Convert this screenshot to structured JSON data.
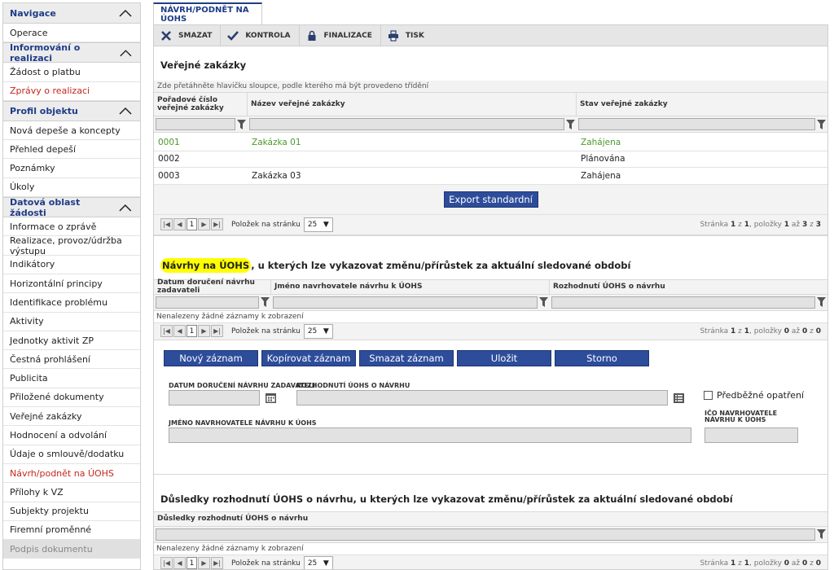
{
  "sidebar": {
    "sections": [
      {
        "title": "Navigace",
        "items": [
          "Operace"
        ]
      },
      {
        "title": "Informování o realizaci",
        "items": [
          "Žádost o platbu",
          "Zprávy o realizaci"
        ]
      },
      {
        "title": "Profil objektu",
        "items": [
          "Nová depeše a koncepty",
          "Přehled depeší",
          "Poznámky",
          "Úkoly"
        ]
      },
      {
        "title": "Datová oblast žádosti",
        "items": [
          "Informace o zprávě",
          "Realizace, provoz/údržba výstupu",
          "Indikátory",
          "Horizontální principy",
          "Identifikace problému",
          "Aktivity",
          "Jednotky aktivit ZP",
          "Čestná prohlášení",
          "Publicita",
          "Přiložené dokumenty",
          "Veřejné zakázky",
          "Hodnocení a odvolání",
          "Údaje o smlouvě/dodatku",
          "Návrh/podnět na ÚOHS",
          "Přílohy k VZ",
          "Subjekty projektu",
          "Firemní proměnné",
          "Podpis dokumentu"
        ]
      }
    ]
  },
  "tab": {
    "label": "NÁVRH/PODNĚT NA ÚOHS"
  },
  "toolbar": {
    "delete": "SMAZAT",
    "check": "KONTROLA",
    "finalize": "FINALIZACE",
    "print": "TISK"
  },
  "contracts": {
    "title": "Veřejné zakázky",
    "hint": "Zde přetáhněte hlavičku sloupce, podle kterého má být provedeno třídění",
    "columns": [
      "Pořadové číslo veřejné zakázky",
      "Název veřejné zakázky",
      "Stav veřejné zakázky"
    ],
    "rows": [
      [
        "0001",
        "Zakázka 01",
        "Zahájena"
      ],
      [
        "0002",
        "",
        "Plánována"
      ],
      [
        "0003",
        "Zakázka 03",
        "Zahájena"
      ]
    ],
    "export_label": "Export standardní",
    "pager": {
      "page": "1",
      "per_page_label": "Položek na stránku",
      "per_page": "25",
      "info_prefix": "Stránka ",
      "page_cur": "1",
      "of": " z ",
      "page_total": "1",
      "items": ", položky ",
      "item_from": "1",
      "to": " až ",
      "item_to": "3",
      "of2": " z ",
      "item_total": "3"
    }
  },
  "proposals": {
    "title_highlight": "Návrhy na ÚOHS",
    "title_rest": ", u kterých lze vykazovat změnu/přírůstek za aktuální sledované období",
    "columns": [
      "Datum doručení návrhu zadavateli",
      "Jméno navrhovatele návrhu k ÚOHS",
      "Rozhodnutí ÚOHS o návrhu"
    ],
    "empty": "Nenalezeny žádné záznamy k zobrazení",
    "pager": {
      "page": "1",
      "per_page_label": "Položek na stránku",
      "per_page": "25",
      "info_prefix": "Stránka ",
      "page_cur": "1",
      "of": " z ",
      "page_total": "1",
      "items": ", položky ",
      "item_from": "0",
      "to": " až ",
      "item_to": "0",
      "of2": " z ",
      "item_total": "0"
    },
    "actions": [
      "Nový záznam",
      "Kopírovat záznam",
      "Smazat záznam",
      "Uložit",
      "Storno"
    ],
    "form": {
      "date_label": "DATUM DORUČENÍ NÁVRHU ZADAVATELI",
      "decision_label": "ROZHODNUTÍ ÚOHS O NÁVRHU",
      "preliminary_label": "Předběžné opatření",
      "name_label": "JMÉNO NAVRHOVATELE NÁVRHU K ÚOHS",
      "ico_label": "IČO NAVRHOVATELE NÁVRHU K ÚOHS"
    }
  },
  "consequences": {
    "title": "Důsledky rozhodnutí ÚOHS o návrhu, u kterých lze vykazovat změnu/přírůstek za aktuální sledované období",
    "column": "Důsledky rozhodnutí ÚOHS o návrhu",
    "empty": "Nenalezeny žádné záznamy k zobrazení",
    "pager": {
      "page": "1",
      "per_page_label": "Položek na stránku",
      "per_page": "25",
      "info_prefix": "Stránka ",
      "page_cur": "1",
      "of": " z ",
      "page_total": "1",
      "items": ", položky ",
      "item_from": "0",
      "to": " až ",
      "item_to": "0",
      "of2": " z ",
      "item_total": "0"
    }
  },
  "colors": {
    "accent": "#2d4d9b",
    "link_red": "#c4261d",
    "green": "#4a9a2c",
    "highlight": "#ffff00"
  },
  "icons": {
    "collapse": "chevron-up-icon",
    "delete": "x-icon",
    "check": "checkmark-icon",
    "finalize": "lock-icon",
    "print": "printer-icon",
    "filter": "funnel-icon",
    "calendar": "calendar-icon",
    "list": "list-icon"
  }
}
